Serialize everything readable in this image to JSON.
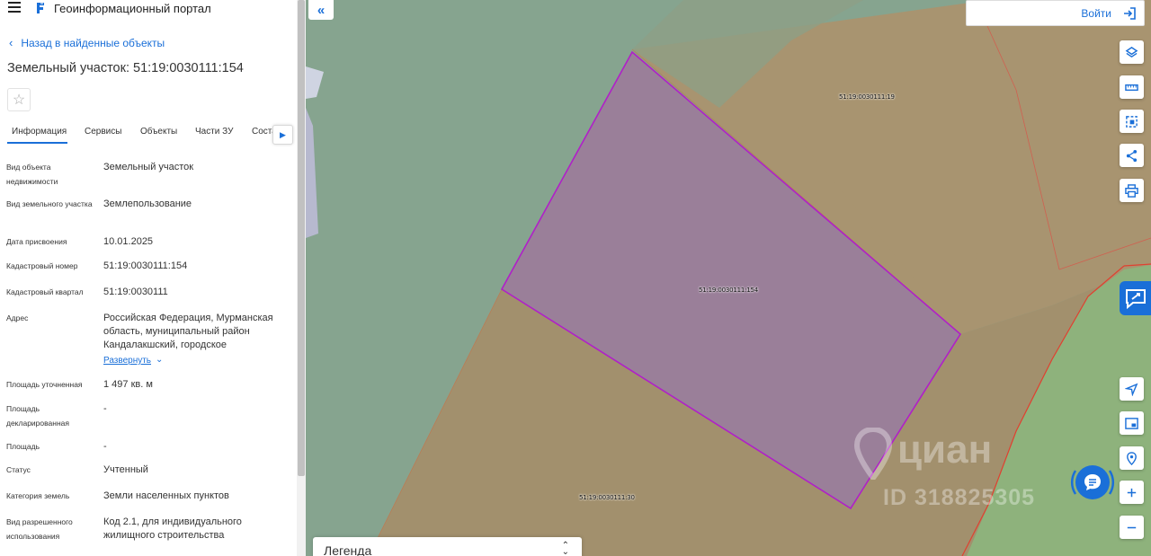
{
  "header": {
    "portal_title": "Геоинформационный портал"
  },
  "nav": {
    "back_label": "Назад в найденные объекты"
  },
  "object": {
    "title": "Земельный участок: 51:19:0030111:154"
  },
  "tabs": [
    {
      "label": "Информация",
      "active": true
    },
    {
      "label": "Сервисы"
    },
    {
      "label": "Объекты"
    },
    {
      "label": "Части ЗУ"
    },
    {
      "label": "Соста"
    }
  ],
  "properties": [
    {
      "label": "Вид объекта недвижимости",
      "value": "Земельный участок"
    },
    {
      "label": "Вид земельного участка",
      "value": "Землепользование"
    },
    {
      "label": "Дата присвоения",
      "value": "10.01.2025"
    },
    {
      "label": "Кадастровый номер",
      "value": "51:19:0030111:154"
    },
    {
      "label": "Кадастровый квартал",
      "value": "51:19:0030111"
    },
    {
      "label": "Адрес",
      "value": "Российская Федерация, Мурманская область, муниципальный район Кандалакшский, городское"
    },
    {
      "label": "Площадь уточненная",
      "value": "1 497 кв. м"
    },
    {
      "label": "Площадь декларированная",
      "value": "-"
    },
    {
      "label": "Площадь",
      "value": "-"
    },
    {
      "label": "Статус",
      "value": "Учтенный"
    },
    {
      "label": "Категория земель",
      "value": "Земли населенных пунктов"
    },
    {
      "label": "Вид разрешенного использования",
      "value": "Код 2.1, для индивидуального жилищного строительства"
    }
  ],
  "address_expand": {
    "label": "Развернуть"
  },
  "map": {
    "login_label": "Войти",
    "legend_label": "Легенда",
    "parcel_labels": {
      "top": "51:19:0030111:19",
      "center": "51:19:0030111:154",
      "bottom": "51:19:0030111:30"
    },
    "watermark": {
      "brand": "циан",
      "id": "ID 318825305"
    }
  },
  "colors": {
    "accent": "#1a6fd8",
    "map_green": "#86a48f",
    "map_brown": "#a89470",
    "selected_parcel_stroke": "#b020c8"
  },
  "icons": [
    "menu-icon",
    "portal-logo-icon",
    "chevron-left-icon",
    "star-icon",
    "chevron-right-icon",
    "chevron-down-icon",
    "double-chevron-left-icon",
    "login-icon",
    "layers-icon",
    "ruler-icon",
    "select-area-icon",
    "share-icon",
    "print-icon",
    "feedback-icon",
    "navigate-icon",
    "minimap-icon",
    "location-icon",
    "plus-icon",
    "minus-icon",
    "sort-icon",
    "chat-icon"
  ]
}
